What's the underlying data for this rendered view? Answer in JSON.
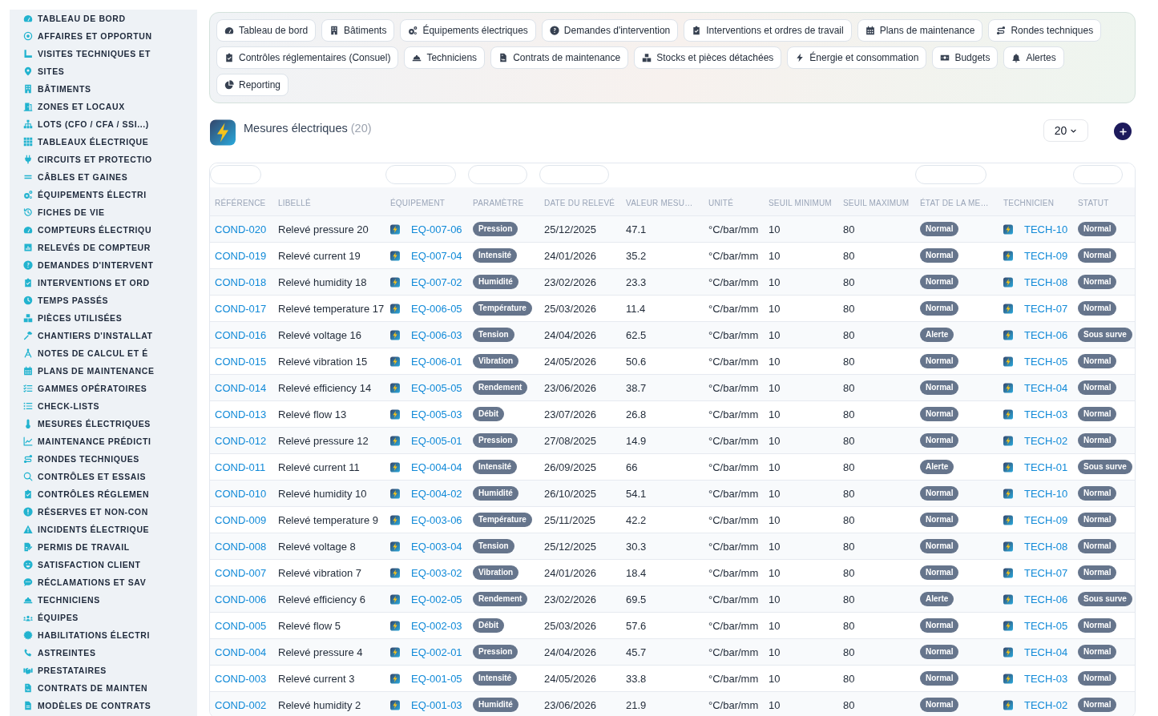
{
  "sidebar": {
    "items": [
      "TABLEAU DE BORD",
      "AFFAIRES ET OPPORTUN",
      "VISITES TECHNIQUES ET",
      "SITES",
      "BÂTIMENTS",
      "ZONES ET LOCAUX",
      "LOTS (CFO / CFA / SSI...)",
      "TABLEAUX ÉLECTRIQUE",
      "CIRCUITS ET PROTECTIO",
      "CÂBLES ET GAINES",
      "ÉQUIPEMENTS ÉLECTRI",
      "FICHES DE VIE",
      "COMPTEURS ÉLECTRIQU",
      "RELEVÉS DE COMPTEUR",
      "DEMANDES D'INTERVENT",
      "INTERVENTIONS ET ORD",
      "TEMPS PASSÉS",
      "PIÈCES UTILISÉES",
      "CHANTIERS D'INSTALLAT",
      "NOTES DE CALCUL ET É",
      "PLANS DE MAINTENANCE",
      "GAMMES OPÉRATOIRES",
      "CHECK-LISTS",
      "MESURES ÉLECTRIQUES",
      "MAINTENANCE PRÉDICTI",
      "RONDES TECHNIQUES",
      "CONTRÔLES ET ESSAIS",
      "CONTRÔLES RÉGLEMEN",
      "RÉSERVES ET NON-CON",
      "INCIDENTS ÉLECTRIQUE",
      "PERMIS DE TRAVAIL",
      "SATISFACTION CLIENT",
      "RÉCLAMATIONS ET SAV",
      "TECHNICIENS",
      "ÉQUIPES",
      "HABILITATIONS ÉLECTRI",
      "ASTREINTES",
      "PRESTATAIRES",
      "CONTRATS DE MAINTEN",
      "MODÈLES DE CONTRATS"
    ]
  },
  "nav": {
    "items": [
      "Tableau de bord",
      "Bâtiments",
      "Équipements électriques",
      "Demandes d'intervention",
      "Interventions et ordres de travail",
      "Plans de maintenance",
      "Rondes techniques",
      "Contrôles réglementaires (Consuel)",
      "Techniciens",
      "Contrats de maintenance",
      "Stocks et pièces détachées",
      "Énergie et consommation",
      "Budgets",
      "Alertes",
      "Reporting"
    ]
  },
  "header": {
    "title": "Mesures électriques",
    "count": "(20)",
    "page_size": "20"
  },
  "table": {
    "columns": [
      {
        "label": "RÉFÉRENCE",
        "kind": "link",
        "filter": true
      },
      {
        "label": "LIBELLÉ",
        "kind": "text",
        "filter": false
      },
      {
        "label": "ÉQUIPEMENT",
        "kind": "icon_link",
        "filter": true
      },
      {
        "label": "PARAMÈTRE",
        "kind": "badge",
        "filter": true
      },
      {
        "label": "DATE DU RELEVÉ",
        "kind": "text",
        "filter": true
      },
      {
        "label": "VALEUR MESU…",
        "kind": "text",
        "filter": false
      },
      {
        "label": "UNITÉ",
        "kind": "text",
        "filter": false
      },
      {
        "label": "SEUIL MINIMUM",
        "kind": "text",
        "filter": false
      },
      {
        "label": "SEUIL MAXIMUM",
        "kind": "text",
        "filter": false
      },
      {
        "label": "ÉTAT DE LA ME…",
        "kind": "badge",
        "filter": true
      },
      {
        "label": "TECHNICIEN",
        "kind": "icon_link",
        "filter": false
      },
      {
        "label": "STATUT",
        "kind": "badge",
        "filter": true
      }
    ],
    "rows": [
      [
        "COND-020",
        "Relevé pressure 20",
        "EQ-007-06",
        "Pression",
        "25/12/2025",
        "47.1",
        "°C/bar/mm",
        "10",
        "80",
        "Normal",
        "TECH-10",
        "Normal"
      ],
      [
        "COND-019",
        "Relevé current 19",
        "EQ-007-04",
        "Intensité",
        "24/01/2026",
        "35.2",
        "°C/bar/mm",
        "10",
        "80",
        "Normal",
        "TECH-09",
        "Normal"
      ],
      [
        "COND-018",
        "Relevé humidity 18",
        "EQ-007-02",
        "Humidité",
        "23/02/2026",
        "23.3",
        "°C/bar/mm",
        "10",
        "80",
        "Normal",
        "TECH-08",
        "Normal"
      ],
      [
        "COND-017",
        "Relevé temperature 17",
        "EQ-006-05",
        "Température",
        "25/03/2026",
        "11.4",
        "°C/bar/mm",
        "10",
        "80",
        "Normal",
        "TECH-07",
        "Normal"
      ],
      [
        "COND-016",
        "Relevé voltage 16",
        "EQ-006-03",
        "Tension",
        "24/04/2026",
        "62.5",
        "°C/bar/mm",
        "10",
        "80",
        "Alerte",
        "TECH-06",
        "Sous surve"
      ],
      [
        "COND-015",
        "Relevé vibration 15",
        "EQ-006-01",
        "Vibration",
        "24/05/2026",
        "50.6",
        "°C/bar/mm",
        "10",
        "80",
        "Normal",
        "TECH-05",
        "Normal"
      ],
      [
        "COND-014",
        "Relevé efficiency 14",
        "EQ-005-05",
        "Rendement",
        "23/06/2026",
        "38.7",
        "°C/bar/mm",
        "10",
        "80",
        "Normal",
        "TECH-04",
        "Normal"
      ],
      [
        "COND-013",
        "Relevé flow 13",
        "EQ-005-03",
        "Débit",
        "23/07/2026",
        "26.8",
        "°C/bar/mm",
        "10",
        "80",
        "Normal",
        "TECH-03",
        "Normal"
      ],
      [
        "COND-012",
        "Relevé pressure 12",
        "EQ-005-01",
        "Pression",
        "27/08/2025",
        "14.9",
        "°C/bar/mm",
        "10",
        "80",
        "Normal",
        "TECH-02",
        "Normal"
      ],
      [
        "COND-011",
        "Relevé current 11",
        "EQ-004-04",
        "Intensité",
        "26/09/2025",
        "66",
        "°C/bar/mm",
        "10",
        "80",
        "Alerte",
        "TECH-01",
        "Sous surve"
      ],
      [
        "COND-010",
        "Relevé humidity 10",
        "EQ-004-02",
        "Humidité",
        "26/10/2025",
        "54.1",
        "°C/bar/mm",
        "10",
        "80",
        "Normal",
        "TECH-10",
        "Normal"
      ],
      [
        "COND-009",
        "Relevé temperature 9",
        "EQ-003-06",
        "Température",
        "25/11/2025",
        "42.2",
        "°C/bar/mm",
        "10",
        "80",
        "Normal",
        "TECH-09",
        "Normal"
      ],
      [
        "COND-008",
        "Relevé voltage 8",
        "EQ-003-04",
        "Tension",
        "25/12/2025",
        "30.3",
        "°C/bar/mm",
        "10",
        "80",
        "Normal",
        "TECH-08",
        "Normal"
      ],
      [
        "COND-007",
        "Relevé vibration 7",
        "EQ-003-02",
        "Vibration",
        "24/01/2026",
        "18.4",
        "°C/bar/mm",
        "10",
        "80",
        "Normal",
        "TECH-07",
        "Normal"
      ],
      [
        "COND-006",
        "Relevé efficiency 6",
        "EQ-002-05",
        "Rendement",
        "23/02/2026",
        "69.5",
        "°C/bar/mm",
        "10",
        "80",
        "Alerte",
        "TECH-06",
        "Sous surve"
      ],
      [
        "COND-005",
        "Relevé flow 5",
        "EQ-002-03",
        "Débit",
        "25/03/2026",
        "57.6",
        "°C/bar/mm",
        "10",
        "80",
        "Normal",
        "TECH-05",
        "Normal"
      ],
      [
        "COND-004",
        "Relevé pressure 4",
        "EQ-002-01",
        "Pression",
        "24/04/2026",
        "45.7",
        "°C/bar/mm",
        "10",
        "80",
        "Normal",
        "TECH-04",
        "Normal"
      ],
      [
        "COND-003",
        "Relevé current 3",
        "EQ-001-05",
        "Intensité",
        "24/05/2026",
        "33.8",
        "°C/bar/mm",
        "10",
        "80",
        "Normal",
        "TECH-03",
        "Normal"
      ],
      [
        "COND-002",
        "Relevé humidity 2",
        "EQ-001-03",
        "Humidité",
        "23/06/2026",
        "21.9",
        "°C/bar/mm",
        "10",
        "80",
        "Normal",
        "TECH-02",
        "Normal"
      ]
    ]
  }
}
